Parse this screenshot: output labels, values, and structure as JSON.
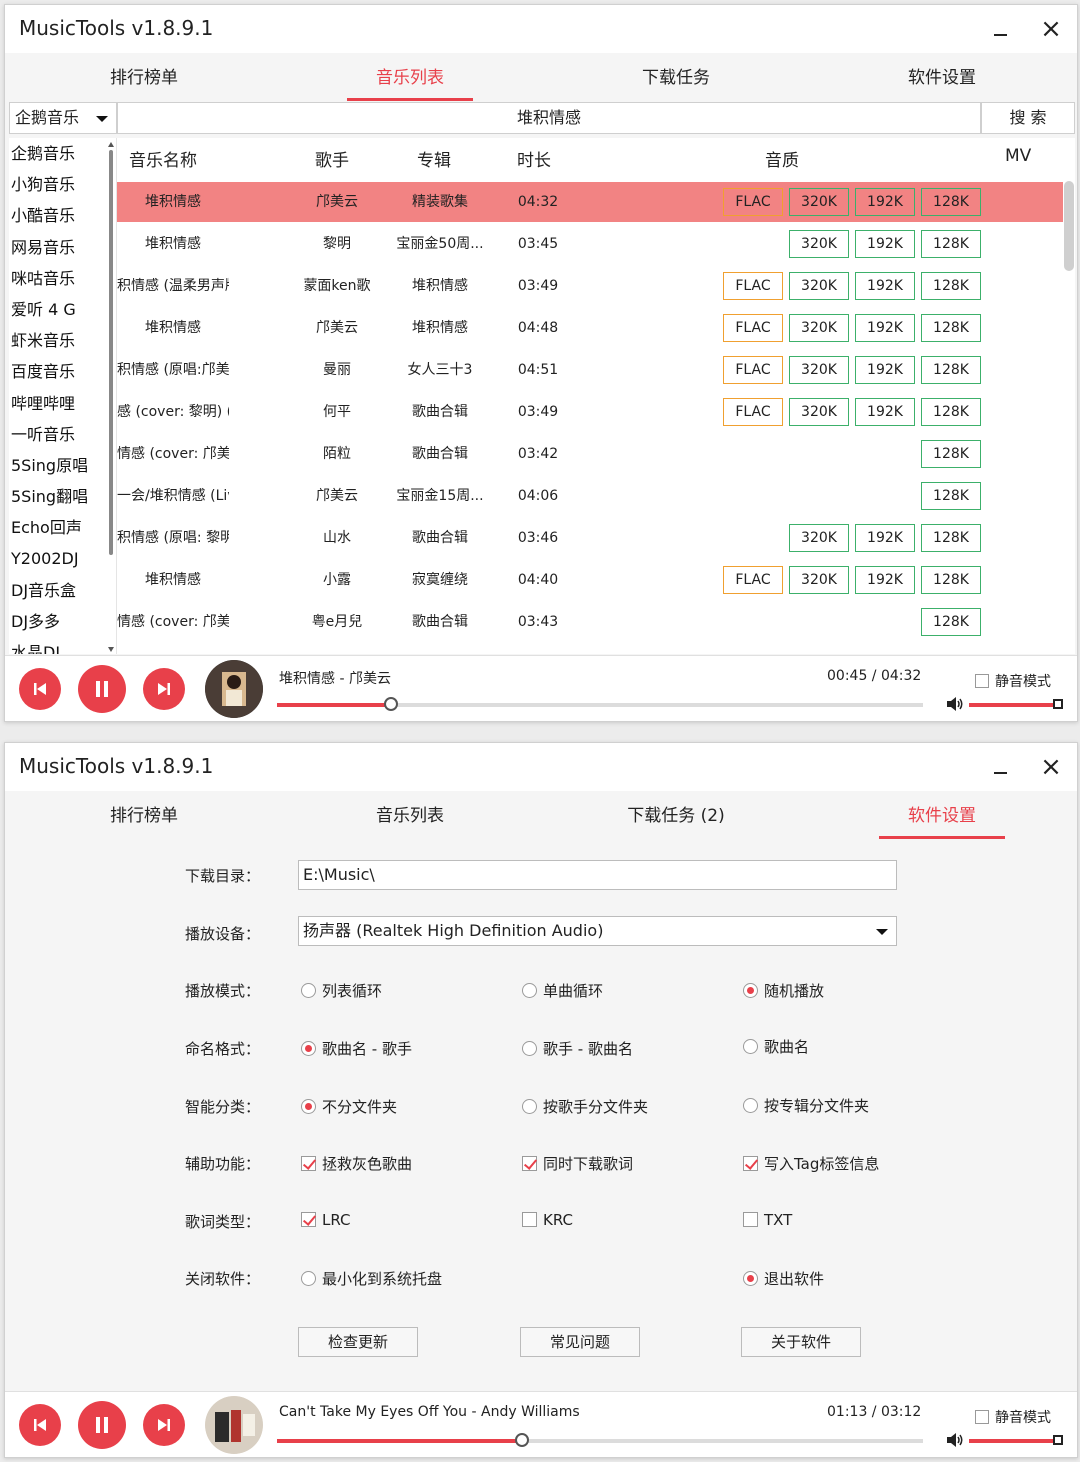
{
  "app": {
    "title": "MusicTools v1.8.9.1",
    "close_glyph": "×"
  },
  "window1": {
    "tabs": [
      "排行榜单",
      "音乐列表",
      "下载任务",
      "软件设置"
    ],
    "active_tab": "音乐列表",
    "source_select": "企鹅音乐",
    "search_query": "堆积情感",
    "search_button": "搜 索",
    "sources": [
      "企鹅音乐",
      "小狗音乐",
      "小酷音乐",
      "网易音乐",
      "咪咕音乐",
      "爱听 4 G",
      "虾米音乐",
      "百度音乐",
      "哔哩哔哩",
      "一听音乐",
      "5Sing原唱",
      "5Sing翻唱",
      "Echo回声",
      "Y2002DJ",
      "DJ音乐盒",
      "DJ多多",
      "水晶DJ"
    ],
    "columns": {
      "name": "音乐名称",
      "singer": "歌手",
      "album": "专辑",
      "duration": "时长",
      "quality": "音质",
      "mv": "MV"
    },
    "songs": [
      {
        "name": "堆积情感",
        "singer": "邝美云",
        "album": "精装歌集",
        "duration": "04:32",
        "q": [
          "FLAC",
          "320K",
          "192K",
          "128K"
        ],
        "selected": true
      },
      {
        "name": "堆积情感",
        "singer": "黎明",
        "album": "宝丽金50周...",
        "duration": "03:45",
        "q": [
          "320K",
          "192K",
          "128K"
        ]
      },
      {
        "name": "积情感 (温柔男声版)",
        "singer": "蒙面ken歌",
        "album": "堆积情感",
        "duration": "03:49",
        "q": [
          "FLAC",
          "320K",
          "192K",
          "128K"
        ]
      },
      {
        "name": "堆积情感",
        "singer": "邝美云",
        "album": "堆积情感",
        "duration": "04:48",
        "q": [
          "FLAC",
          "320K",
          "192K",
          "128K"
        ]
      },
      {
        "name": "积情感 (原唱:邝美云)",
        "singer": "曼丽",
        "album": "女人三十3",
        "duration": "04:51",
        "q": [
          "FLAC",
          "320K",
          "192K",
          "128K"
        ]
      },
      {
        "name": "感 (cover: 黎明) (Live)",
        "singer": "何平",
        "album": "歌曲合辑",
        "duration": "03:49",
        "q": [
          "FLAC",
          "320K",
          "192K",
          "128K"
        ]
      },
      {
        "name": "情感 (cover: 邝美云)",
        "singer": "陌粒",
        "album": "歌曲合辑",
        "duration": "03:42",
        "q": [
          "128K"
        ]
      },
      {
        "name": "一会/堆积情感 (Live)",
        "singer": "邝美云",
        "album": "宝丽金15周...",
        "duration": "04:06",
        "q": [
          "128K"
        ]
      },
      {
        "name": "积情感 (原唱: 黎明)",
        "singer": "山水",
        "album": "歌曲合辑",
        "duration": "03:46",
        "q": [
          "320K",
          "192K",
          "128K"
        ]
      },
      {
        "name": "堆积情感",
        "singer": "小露",
        "album": "寂寞缠绕",
        "duration": "04:40",
        "q": [
          "FLAC",
          "320K",
          "192K",
          "128K"
        ]
      },
      {
        "name": "情感 (cover: 邝美云)",
        "singer": "粤e月兒",
        "album": "歌曲合辑",
        "duration": "03:43",
        "q": [
          "128K"
        ]
      }
    ],
    "player": {
      "now_playing": "堆积情感 - 邝美云",
      "time": "00:45 / 04:32",
      "progress": 0.177,
      "mute_label": "静音模式"
    }
  },
  "window2": {
    "tabs": [
      "排行榜单",
      "音乐列表",
      "下载任务 (2)",
      "软件设置"
    ],
    "active_tab": "软件设置",
    "download_dir": {
      "label": "下载目录：",
      "value": "E:\\Music\\"
    },
    "device": {
      "label": "播放设备：",
      "value": "扬声器 (Realtek High Definition Audio)"
    },
    "play_mode": {
      "label": "播放模式：",
      "options": [
        "列表循环",
        "单曲循环",
        "随机播放"
      ],
      "selected": 2
    },
    "name_format": {
      "label": "命名格式：",
      "options": [
        "歌曲名 - 歌手",
        "歌手 - 歌曲名",
        "歌曲名"
      ],
      "selected": 0
    },
    "smart_sort": {
      "label": "智能分类：",
      "options": [
        "不分文件夹",
        "按歌手分文件夹",
        "按专辑分文件夹"
      ],
      "selected": 0
    },
    "aux": {
      "label": "辅助功能：",
      "options": [
        "拯救灰色歌曲",
        "同时下载歌词",
        "写入Tag标签信息"
      ],
      "checked": [
        true,
        true,
        true
      ]
    },
    "lyric_type": {
      "label": "歌词类型：",
      "options": [
        "LRC",
        "KRC",
        "TXT"
      ],
      "checked": [
        true,
        false,
        false
      ]
    },
    "close_action": {
      "label": "关闭软件：",
      "options": [
        "最小化到系统托盘",
        "退出软件"
      ],
      "selected": 1
    },
    "buttons": [
      "检查更新",
      "常见问题",
      "关于软件"
    ],
    "player": {
      "now_playing": "Can't Take My Eyes Off You - Andy Williams",
      "time": "01:13 / 03:12",
      "progress": 0.38,
      "mute_label": "静音模式"
    }
  },
  "colors": {
    "accent": "#e8404a",
    "selected_row": "#f28383",
    "flac_border": "#f0a030",
    "quality_border": "#3cb06a"
  },
  "icons": [
    "prev-icon",
    "pause-icon",
    "next-icon",
    "volume-icon",
    "chevron-down-icon",
    "close-icon",
    "minimize-icon"
  ]
}
